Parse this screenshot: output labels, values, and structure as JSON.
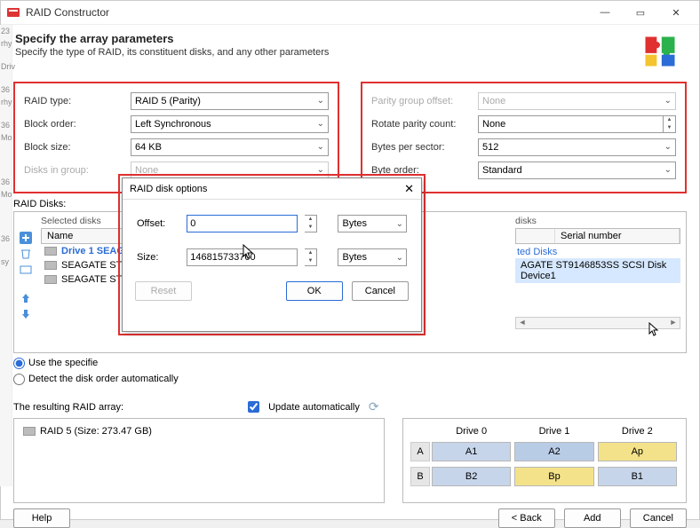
{
  "window": {
    "title": "RAID Constructor"
  },
  "header": {
    "title": "Specify the array parameters",
    "subtitle": "Specify the type of RAID, its constituent disks, and any other parameters"
  },
  "left_params": {
    "raid_type_label": "RAID type:",
    "raid_type_value": "RAID 5 (Parity)",
    "block_order_label": "Block order:",
    "block_order_value": "Left Synchronous",
    "block_size_label": "Block size:",
    "block_size_value": "64 KB",
    "disks_in_group_label": "Disks in group:",
    "disks_in_group_value": "None"
  },
  "right_params": {
    "parity_offset_label": "Parity group offset:",
    "parity_offset_value": "None",
    "rotate_parity_label": "Rotate parity count:",
    "rotate_parity_value": "None",
    "bytes_per_sector_label": "Bytes per sector:",
    "bytes_per_sector_value": "512",
    "byte_order_label": "Byte order:",
    "byte_order_value": "Standard"
  },
  "raid_disks": {
    "section_label": "RAID Disks:",
    "selected_title": "Selected disks",
    "name_col": "Name",
    "items": [
      {
        "label": "Drive 1 SEAG"
      },
      {
        "label": "SEAGATE ST"
      },
      {
        "label": "SEAGATE ST"
      }
    ],
    "connected_title_suffix": "ted Disks",
    "connected_col_partial": "disks",
    "serial_col": "Serial number",
    "connected_item": "AGATE ST9146853SS SCSI Disk Device1",
    "radio_specified": "Use the specifie",
    "radio_auto": "Detect the disk order automatically"
  },
  "result": {
    "label": "The resulting RAID array:",
    "update_label": "Update automatically",
    "array_text": "RAID 5 (Size: 273.47 GB)"
  },
  "grid": {
    "headers": [
      "Drive 0",
      "Drive 1",
      "Drive 2"
    ],
    "rows": [
      {
        "label": "A",
        "cells": [
          "A1",
          "A2",
          "Ap"
        ],
        "parity_index": 2
      },
      {
        "label": "B",
        "cells": [
          "B2",
          "Bp",
          "B1"
        ],
        "parity_index": 1
      }
    ]
  },
  "modal": {
    "title": "RAID disk options",
    "offset_label": "Offset:",
    "offset_value": "0",
    "offset_unit": "Bytes",
    "size_label": "Size:",
    "size_value": "146815733760",
    "size_unit": "Bytes",
    "reset": "Reset",
    "ok": "OK",
    "cancel": "Cancel"
  },
  "footer": {
    "help": "Help",
    "back": "< Back",
    "add": "Add",
    "cancel": "Cancel"
  }
}
